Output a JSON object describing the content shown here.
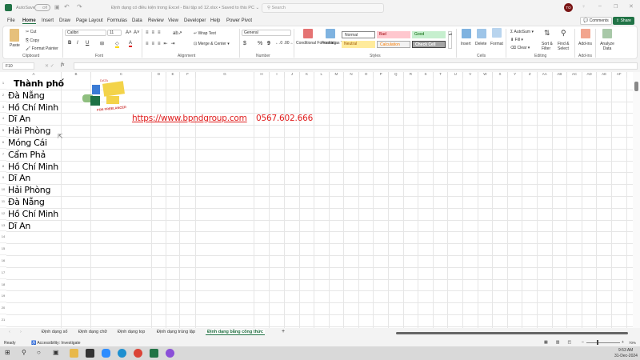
{
  "titlebar": {
    "autosave": "AutoSave",
    "autosave_state": "Off",
    "doc_title": "Định dạng có điều kiện trong Excel - Bài tập số 12.xlsx • Saved to this PC ⌄",
    "search_placeholder": "Search",
    "avatar": "TO"
  },
  "tabs": [
    "File",
    "Home",
    "Insert",
    "Draw",
    "Page Layout",
    "Formulas",
    "Data",
    "Review",
    "View",
    "Developer",
    "Help",
    "Power Pivot"
  ],
  "active_tab": "Home",
  "actions": {
    "comments": "Comments",
    "share": "Share"
  },
  "ribbon": {
    "clipboard": {
      "paste": "Paste",
      "cut": "Cut",
      "copy": "Copy",
      "format_painter": "Format Painter",
      "label": "Clipboard"
    },
    "font": {
      "name": "Calibri",
      "size": "11",
      "bold": "B",
      "italic": "I",
      "underline": "U",
      "label": "Font"
    },
    "alignment": {
      "wrap": "Wrap Text",
      "merge": "Merge & Center",
      "label": "Alignment"
    },
    "number": {
      "format": "General",
      "currency": "$",
      "percent": "%",
      "comma": "9",
      "label": "Number"
    },
    "styles": {
      "conditional": "Conditional Formatting",
      "format_table": "Format as Table",
      "cells": [
        {
          "label": "Normal",
          "bg": "#ffffff",
          "fg": "#000000"
        },
        {
          "label": "Bad",
          "bg": "#ffc7ce",
          "fg": "#9c0006"
        },
        {
          "label": "Good",
          "bg": "#c6efce",
          "fg": "#006100"
        },
        {
          "label": "Neutral",
          "bg": "#ffeb9c",
          "fg": "#9c5700"
        },
        {
          "label": "Calculation",
          "bg": "#f2f2f2",
          "fg": "#fa7d00"
        },
        {
          "label": "Check Cell",
          "bg": "#a5a5a5",
          "fg": "#ffffff"
        }
      ],
      "label": "Styles"
    },
    "cells": {
      "insert": "Insert",
      "delete": "Delete",
      "format": "Format",
      "label": "Cells"
    },
    "editing": {
      "autosum": "AutoSum",
      "fill": "Fill",
      "clear": "Clear",
      "sort": "Sort & Filter",
      "find": "Find & Select",
      "label": "Editing"
    },
    "addins": {
      "addins": "Add-ins",
      "analyze": "Analyze Data",
      "label": "Add-ins"
    }
  },
  "formula_bar": {
    "name_box": "F10",
    "fx": "fx",
    "value": ""
  },
  "columns": [
    "A",
    "B",
    "C",
    "D",
    "E",
    "F",
    "G",
    "H",
    "I",
    "J",
    "K",
    "L",
    "M",
    "N",
    "O",
    "P",
    "Q",
    "R",
    "S",
    "T",
    "U",
    "V",
    "W",
    "X",
    "Y",
    "Z",
    "AA",
    "AB",
    "AC",
    "AD",
    "AE",
    "AF"
  ],
  "rows": [
    "1",
    "2",
    "3",
    "4",
    "5",
    "6",
    "7",
    "8",
    "9",
    "10",
    "11",
    "12",
    "13",
    "14",
    "15",
    "16",
    "17",
    "18",
    "19",
    "20",
    "21"
  ],
  "cells": {
    "header": "Thành phố",
    "cities": [
      "Đà Nẵng",
      "Hồ Chí Minh",
      "Dĩ An",
      "Hải Phòng",
      "Móng Cái",
      "Cẩm Phả",
      "Hồ Chí Minh",
      "Dĩ An",
      "Hải Phòng",
      "Đà Nẵng",
      "Hồ Chí Minh",
      "Dĩ An"
    ]
  },
  "logo": {
    "text_top": "DATA",
    "text_bottom": "FOR FREELANCER"
  },
  "link": {
    "url": "https://www.bpndgroup.com",
    "phone": "0567.602.666",
    "color": "#e02020"
  },
  "sheets": [
    "Định dạng số",
    "Định dạng chữ",
    "Định dạng top",
    "Định dạng trùng lặp",
    "Định dạng bằng công thức"
  ],
  "active_sheet": "Định dạng bằng công thức",
  "status": {
    "ready": "Ready",
    "accessibility": "Accessibility: Investigate",
    "zoom": "70%"
  },
  "taskbar": {
    "time": "9:53 AM",
    "date": "31-Dec-2024"
  },
  "colors": {
    "accent": "#217346"
  }
}
